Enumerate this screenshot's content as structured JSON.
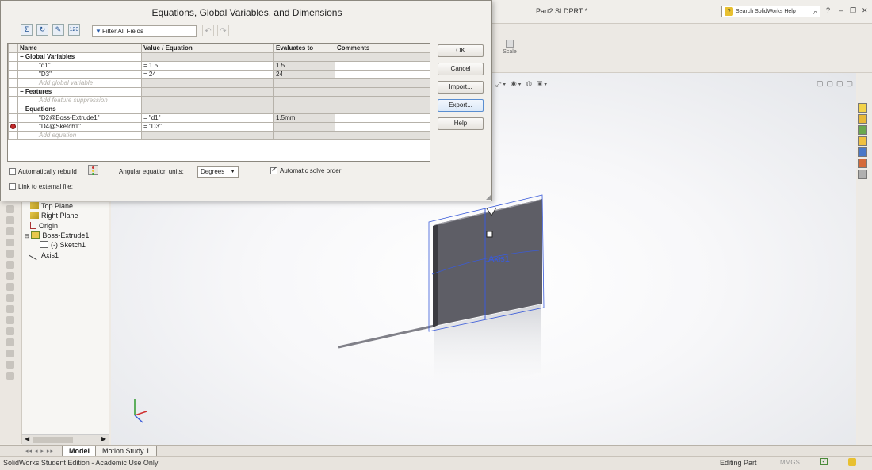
{
  "app": {
    "document_title": "Part2.SLDPRT *",
    "help_search_placeholder": "Search SolidWorks Help",
    "scale_label": "Scale"
  },
  "dialog": {
    "title": "Equations, Global Variables, and Dimensions",
    "filter_placeholder": "Filter All Fields",
    "columns": [
      "Name",
      "Value / Equation",
      "Evaluates to",
      "Comments"
    ],
    "sections": {
      "global_variables": "Global Variables",
      "features": "Features",
      "equations": "Equations"
    },
    "global_rows": [
      {
        "name": "\"d1\"",
        "value": "= 1.5",
        "evaluates": "1.5",
        "comment": ""
      },
      {
        "name": "\"D3\"",
        "value": "= 24",
        "evaluates": "24",
        "comment": ""
      }
    ],
    "add_global_placeholder": "Add global variable",
    "add_feature_placeholder": "Add feature suppression",
    "equation_rows": [
      {
        "name": "\"D2@Boss-Extrude1\"",
        "value": "= \"d1\"",
        "evaluates": "1.5mm",
        "comment": "",
        "error": false
      },
      {
        "name": "\"D4@Sketch1\"",
        "value": "= \"D3\"",
        "evaluates": "",
        "comment": "",
        "error": true
      }
    ],
    "add_equation_placeholder": "Add equation",
    "buttons": {
      "ok": "OK",
      "cancel": "Cancel",
      "import": "Import...",
      "export": "Export...",
      "help": "Help"
    },
    "auto_rebuild_label": "Automatically rebuild",
    "auto_rebuild_checked": false,
    "angular_units_label": "Angular equation units:",
    "angular_units_value": "Degrees",
    "auto_solve_label": "Automatic solve order",
    "auto_solve_checked": true,
    "link_external_label": "Link to external file:",
    "link_external_checked": false
  },
  "feature_tree": {
    "items": [
      "Top Plane",
      "Right Plane",
      "Origin",
      "Boss-Extrude1",
      "(-) Sketch1",
      "Axis1"
    ]
  },
  "viewport": {
    "axis_label": "Axis1"
  },
  "tabs": {
    "model": "Model",
    "motion_study": "Motion Study 1"
  },
  "status_bar": {
    "edition": "SolidWorks Student Edition - Academic Use Only",
    "mode": "Editing Part",
    "units": "MMGS"
  },
  "colors": {
    "part_face": "#5e5e66",
    "selection_blue": "#3a5bd9",
    "error_red": "#c42a2a"
  }
}
